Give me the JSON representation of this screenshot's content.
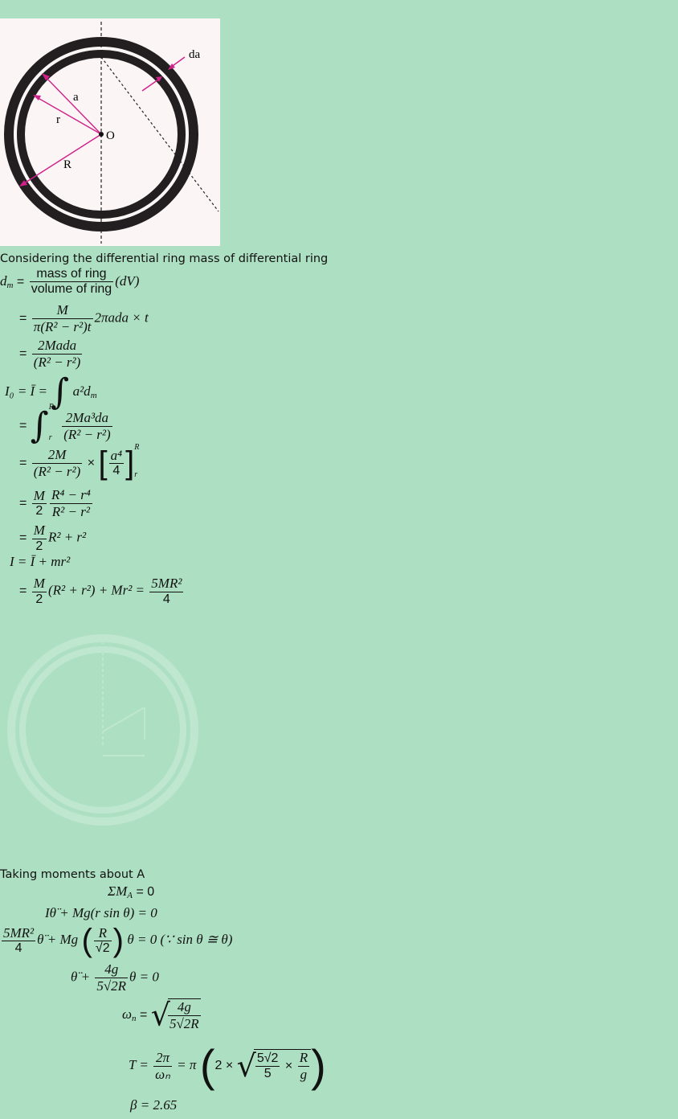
{
  "figure1": {
    "labels": {
      "da": "da",
      "a": "a",
      "r": "r",
      "O": "O",
      "R": "R"
    }
  },
  "text": {
    "intro": "Considering the differential ring mass of differential ring",
    "moments": "Taking moments about A"
  },
  "eq": {
    "dm_lhs": "d",
    "dm_sub": "m",
    "mass_of_ring": "mass of ring",
    "volume_of_ring": "volume of ring",
    "dV": "(dV)",
    "M": "M",
    "pi_den": "π(R² − r²)t",
    "two_pi_a_da": "2πada × t",
    "two_M_a_da": "2Mada",
    "R2_minus_r2": "(R² − r²)",
    "I0_lhs": "I₀ = Ī = ",
    "a2dm": "a²d",
    "int_upper": "R",
    "int_lower": "r",
    "two_M_a3_da": "2Ma³da",
    "two_M": "2M",
    "a4": "a⁴",
    "four": "4",
    "two": "2",
    "R4_minus_r4": "R⁴ − r⁴",
    "R2_minus_r2_plain": "R² − r²",
    "R2_plus_r2": "R² + r²",
    "parallel_axis": "I = Ī + mr²",
    "final_mid": "(R² + r²) + Mr² = ",
    "five_M_R2": "5MR²",
    "sum_MA": "ΣM",
    "sum_MA_sub": "A",
    "eq_zero": " = 0",
    "eq2": "Iθ̈ + Mg(r sin θ) = 0",
    "eq3_mid": "θ̈ + Mg",
    "eq3_R": "R",
    "eq3_sqrt2": "√2",
    "eq3_end": "θ = 0  (∵ sin θ ≅ θ)",
    "eq4_start": "θ̈ + ",
    "four_g": "4g",
    "five_sqrt2_R": "5√2R",
    "eq4_end": "θ = 0",
    "omega_n": "ω",
    "omega_sub": "n",
    "T_lhs": "T = ",
    "two_pi": "2π",
    "omega_n_den": "ωₙ",
    "T_mid": " = π",
    "T_inner": "2 × ",
    "five_sqrt2": "5√2",
    "five": "5",
    "times": " × ",
    "g": "g",
    "beta": "β = 2.65"
  }
}
